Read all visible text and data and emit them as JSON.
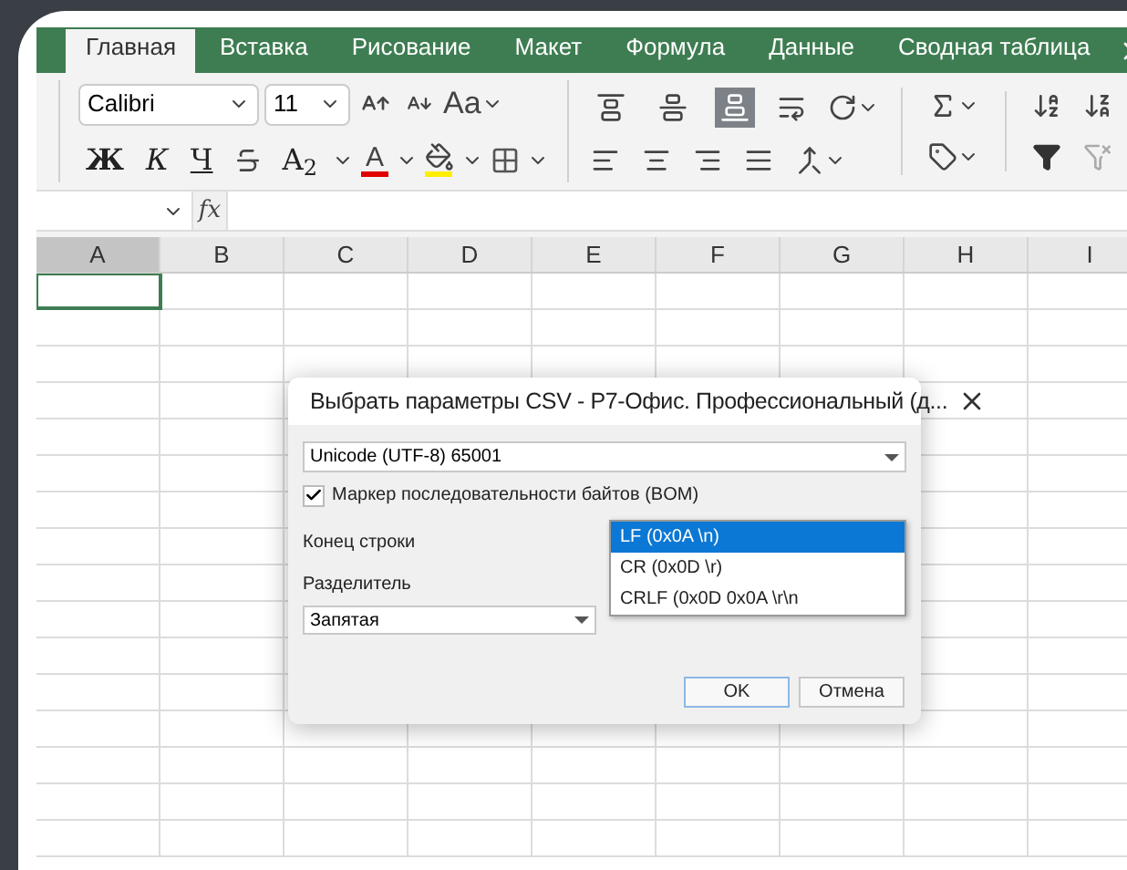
{
  "tabs": [
    {
      "label": "Главная",
      "selected": true
    },
    {
      "label": "Вставка",
      "selected": false
    },
    {
      "label": "Рисование",
      "selected": false
    },
    {
      "label": "Макет",
      "selected": false
    },
    {
      "label": "Формула",
      "selected": false
    },
    {
      "label": "Данные",
      "selected": false
    },
    {
      "label": "Сводная таблица",
      "selected": false
    }
  ],
  "ribbon": {
    "font": "Calibri",
    "size": "11",
    "case_label": "Aa",
    "text_buttons": [
      {
        "kind": "bold",
        "label": "Ж"
      },
      {
        "kind": "italic",
        "label": "К"
      },
      {
        "kind": "underline",
        "label": "Ч"
      },
      {
        "kind": "subscript",
        "label": "A$_{2}$"
      }
    ],
    "font_color": {
      "label": "A"
    },
    "vertical_align": [
      {
        "selected": false
      },
      {
        "selected": false
      },
      {
        "selected": true
      }
    ]
  },
  "formula_bar": {
    "fx": "fx"
  },
  "columns": [
    {
      "label": "A",
      "selected": true
    },
    {
      "label": "B",
      "selected": false
    },
    {
      "label": "C",
      "selected": false
    },
    {
      "label": "D",
      "selected": false
    },
    {
      "label": "E",
      "selected": false
    },
    {
      "label": "F",
      "selected": false
    },
    {
      "label": "G",
      "selected": false
    },
    {
      "label": "H",
      "selected": false
    },
    {
      "label": "I",
      "selected": false
    }
  ],
  "dialog": {
    "title": "Выбрать параметры CSV - Р7-Офис. Профессиональный (д...",
    "encoding": "Unicode (UTF-8) 65001",
    "bom": {
      "label": "Маркер последовательности байтов (BOM)",
      "checked": true
    },
    "line_end_label": "Конец строки",
    "separator_label": "Разделитель",
    "separator": "Запятая",
    "line_end_options": [
      {
        "label": "LF (0x0A \\n)",
        "selected": true
      },
      {
        "label": "CR (0x0D \\r)",
        "selected": false
      },
      {
        "label": "CRLF (0x0D 0x0A \\r\\n",
        "selected": false
      }
    ],
    "buttons": [
      "OK",
      "Отмена"
    ]
  }
}
